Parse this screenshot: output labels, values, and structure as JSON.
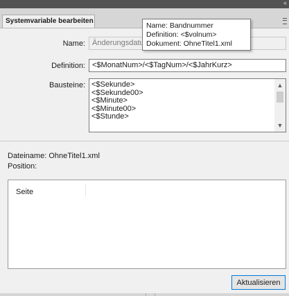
{
  "panel": {
    "collapse_glyph": "«",
    "tab_label": "Systemvariable bearbeiten"
  },
  "tooltip": {
    "line1": "Name: Bandnummer",
    "line2": "Definition: <$volnum>",
    "line3": "Dokument: OhneTitel1.xml"
  },
  "form": {
    "name_label": "Name:",
    "name_value": "Änderungsdatum",
    "definition_label": "Definition:",
    "definition_value": "<$MonatNum>/<$TagNum>/<$JahrKurz>",
    "bausteine_label": "Bausteine:",
    "bausteine_items": [
      "<$Sekunde>",
      "<$Sekunde00>",
      "<$Minute>",
      "<$Minute00>",
      "<$Stunde>"
    ]
  },
  "info": {
    "dateiname_label": "Dateiname:",
    "dateiname_value": "OhneTitel1.xml",
    "position_label": "Position:"
  },
  "table": {
    "column_header": "Seite"
  },
  "buttons": {
    "update_label": "Aktualisieren"
  },
  "icons": {
    "collapse": "double-chevron-left-icon",
    "panel_menu": "hamburger-menu-icon",
    "scroll_up": "chevron-up-icon",
    "scroll_down": "chevron-down-icon"
  },
  "colors": {
    "titlebar": "#535353",
    "tab_strip": "#d6d6d6",
    "panel_bg": "#f0f0f0",
    "button_focus_border": "#0078d7"
  }
}
